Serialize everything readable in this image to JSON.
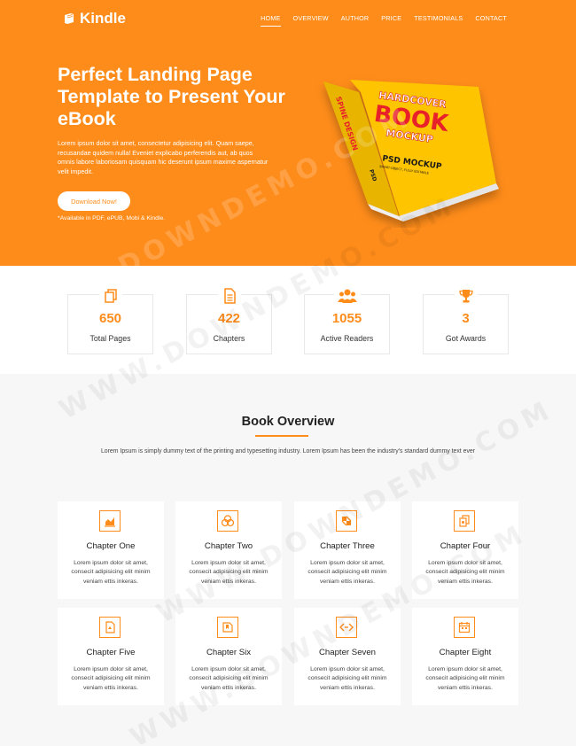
{
  "brand": {
    "name": "Kindle",
    "accent": "#fe8c1a"
  },
  "nav": {
    "items": [
      "HOME",
      "OVERVIEW",
      "AUTHOR",
      "PRICE",
      "TESTIMONIALS",
      "CONTACT"
    ],
    "active": "HOME"
  },
  "hero": {
    "title": "Perfect Landing Page Template to Present Your eBook",
    "text": "Lorem ipsum dolor sit amet, consectetur adipisicing elit. Quam saepe, recusandae quidem nulla! Eveniet explicabo perferendis aut, ab quos omnis labore laboriosam quisquam hic deserunt ipsum maxime aspernatur velit impedit.",
    "cta": "Download Now!",
    "availability": "*Available in PDF, ePUB, Mobi & Kindle.",
    "mockup": {
      "top_label": "HARDCOVER",
      "big_label": "BOOK",
      "sub_label": "MOCKUP",
      "psd": "PSD MOCKUP",
      "psd_sub": "SMART-OBJECT, FULLY EDITABLE",
      "spine": "SPINE DESIGN",
      "spine_small": "PSD"
    }
  },
  "stats": [
    {
      "icon": "pages-icon",
      "value": "650",
      "label": "Total Pages"
    },
    {
      "icon": "document-icon",
      "value": "422",
      "label": "Chapters"
    },
    {
      "icon": "users-icon",
      "value": "1055",
      "label": "Active Readers"
    },
    {
      "icon": "trophy-icon",
      "value": "3",
      "label": "Got Awards"
    }
  ],
  "overview": {
    "title": "Book Overview",
    "description": "Lorem Ipsum is simply dummy text of the printing and typesetting industry. Lorem Ipsum has been the industry's standard dummy text ever",
    "chapters": [
      {
        "icon": "chart-icon",
        "title": "Chapter One",
        "text": "Lorem ipsum dolor sit amet, consecit adipisicing elit minim veniam ettis inkeras."
      },
      {
        "icon": "coins-icon",
        "title": "Chapter Two",
        "text": "Lorem ipsum dolor sit amet, consecit adipisicing elit minim veniam ettis inkeras."
      },
      {
        "icon": "puzzle-icon",
        "title": "Chapter Three",
        "text": "Lorem ipsum dolor sit amet, consecit adipisicing elit minim veniam ettis inkeras."
      },
      {
        "icon": "copy-icon",
        "title": "Chapter Four",
        "text": "Lorem ipsum dolor sit amet, consecit adipisicing elit minim veniam ettis inkeras."
      },
      {
        "icon": "file-icon",
        "title": "Chapter Five",
        "text": "Lorem ipsum dolor sit amet, consecit adipisicing elit minim veniam ettis inkeras."
      },
      {
        "icon": "bookmark-icon",
        "title": "Chapter Six",
        "text": "Lorem ipsum dolor sit amet, consecit adipisicing elit minim veniam ettis inkeras."
      },
      {
        "icon": "code-icon",
        "title": "Chapter Seven",
        "text": "Lorem ipsum dolor sit amet, consecit adipisicing elit minim veniam ettis inkeras."
      },
      {
        "icon": "calendar-icon",
        "title": "Chapter Eight",
        "text": "Lorem ipsum dolor sit amet, consecit adipisicing elit minim veniam ettis inkeras."
      }
    ]
  },
  "watermark": "WWW.DOWNDEMO.COM"
}
